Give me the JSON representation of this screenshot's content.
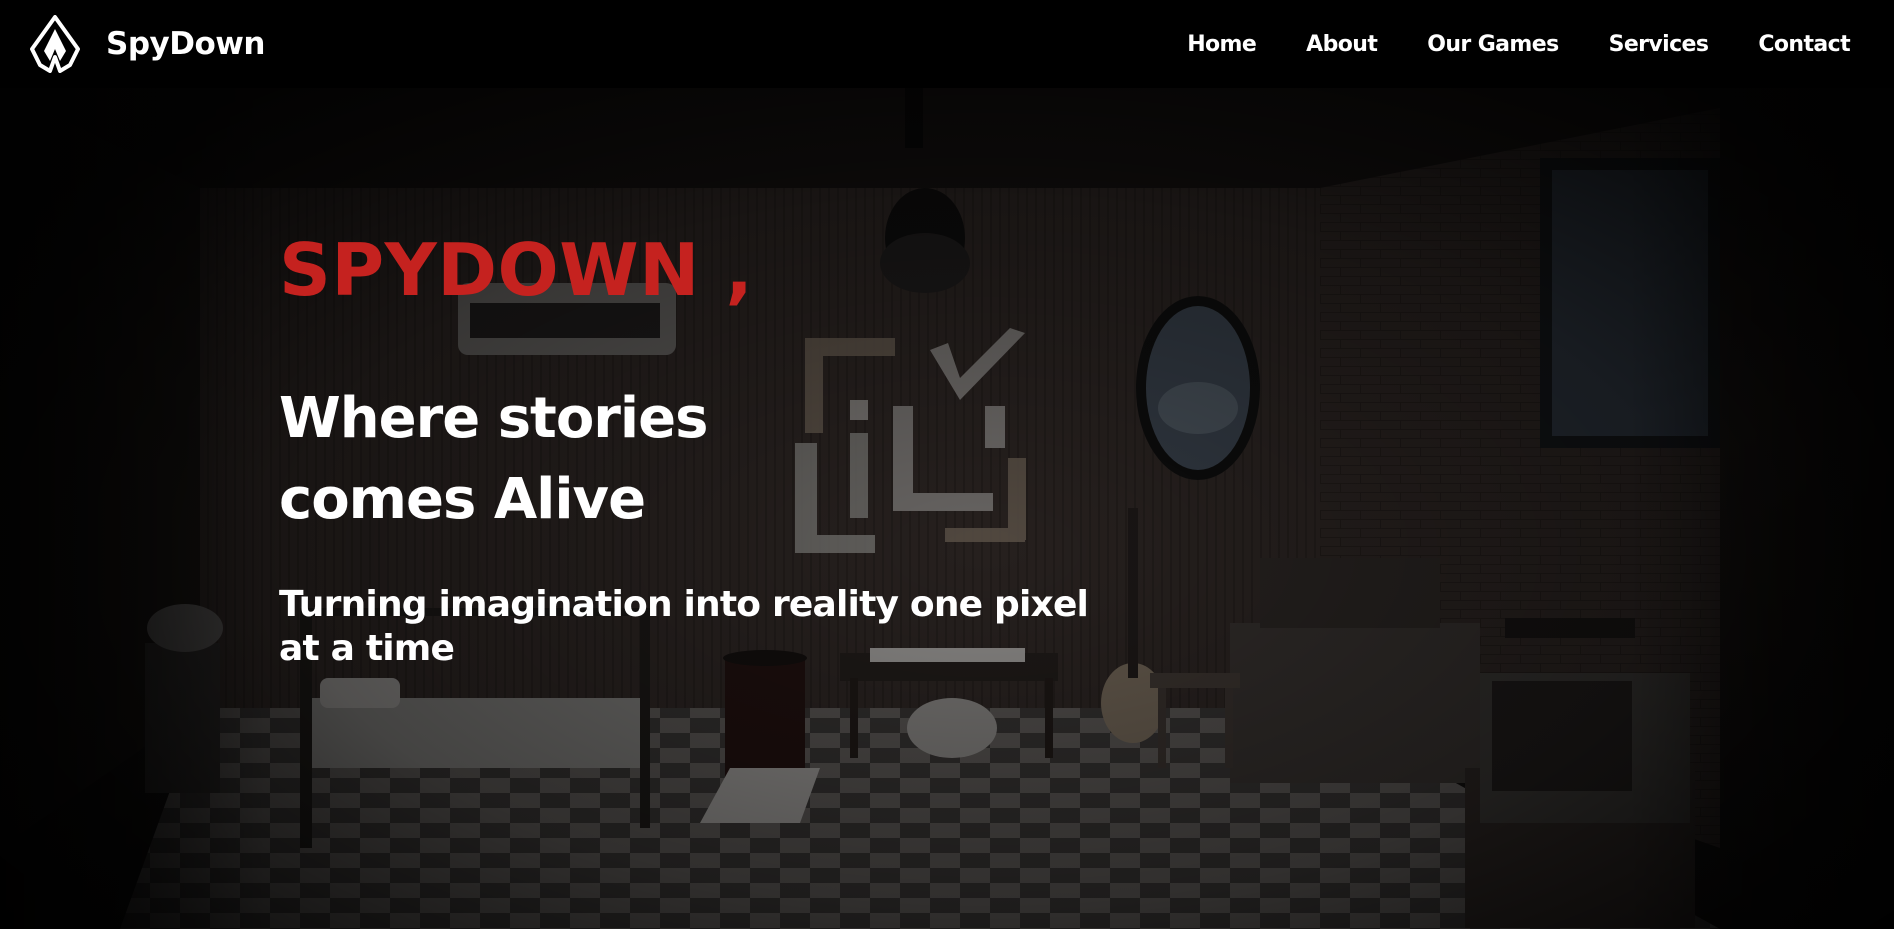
{
  "header": {
    "brand_name": "SpyDown",
    "logo_icon": "spydown-logo-icon",
    "nav": [
      {
        "label": "Home"
      },
      {
        "label": "About"
      },
      {
        "label": "Our Games"
      },
      {
        "label": "Services"
      },
      {
        "label": "Contact"
      }
    ]
  },
  "hero": {
    "brand_heading": "SPYDOWN ,",
    "tagline": "Where stories comes Alive",
    "subtitle": "Turning imagination into reality one pixel at a time",
    "background_image": "dark-bedroom-game-scene",
    "wall_sign": "LiLY"
  },
  "colors": {
    "accent": "#c5221f",
    "nav_background": "#000000",
    "text": "#ffffff"
  }
}
